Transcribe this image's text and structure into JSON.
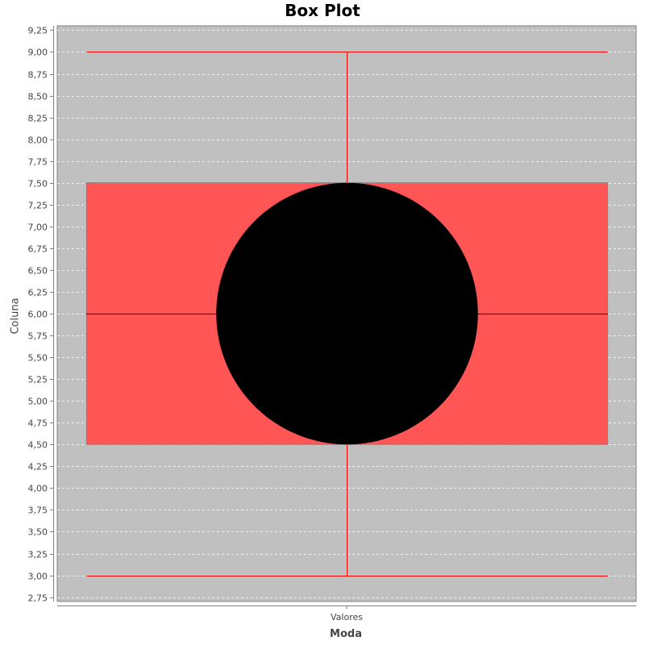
{
  "chart_data": {
    "type": "box",
    "title": "Box Plot",
    "xlabel": "Moda",
    "ylabel": "Coluna",
    "categories": [
      "Valores"
    ],
    "boxes": [
      {
        "category": "Valores",
        "min": 3.0,
        "q1": 4.5,
        "median": 6.0,
        "mean": 6.0,
        "q3": 7.5,
        "max": 9.0
      }
    ],
    "ylim": [
      2.7,
      9.3
    ],
    "ytick_step": 0.25,
    "ytick_labels": [
      "2,75",
      "3,00",
      "3,25",
      "3,50",
      "3,75",
      "4,00",
      "4,25",
      "4,50",
      "4,75",
      "5,00",
      "5,25",
      "5,50",
      "5,75",
      "6,00",
      "6,25",
      "6,50",
      "6,75",
      "7,00",
      "7,25",
      "7,50",
      "7,75",
      "8,00",
      "8,25",
      "8,50",
      "8,75",
      "9,00",
      "9,25"
    ],
    "grid": true,
    "colors": {
      "plot_background": "#c0c0c0",
      "box_fill": "#ff5555",
      "whisker": "#ff0000",
      "median": "#000000",
      "mean_marker": "#000000",
      "gridline": "#ffffff"
    }
  }
}
